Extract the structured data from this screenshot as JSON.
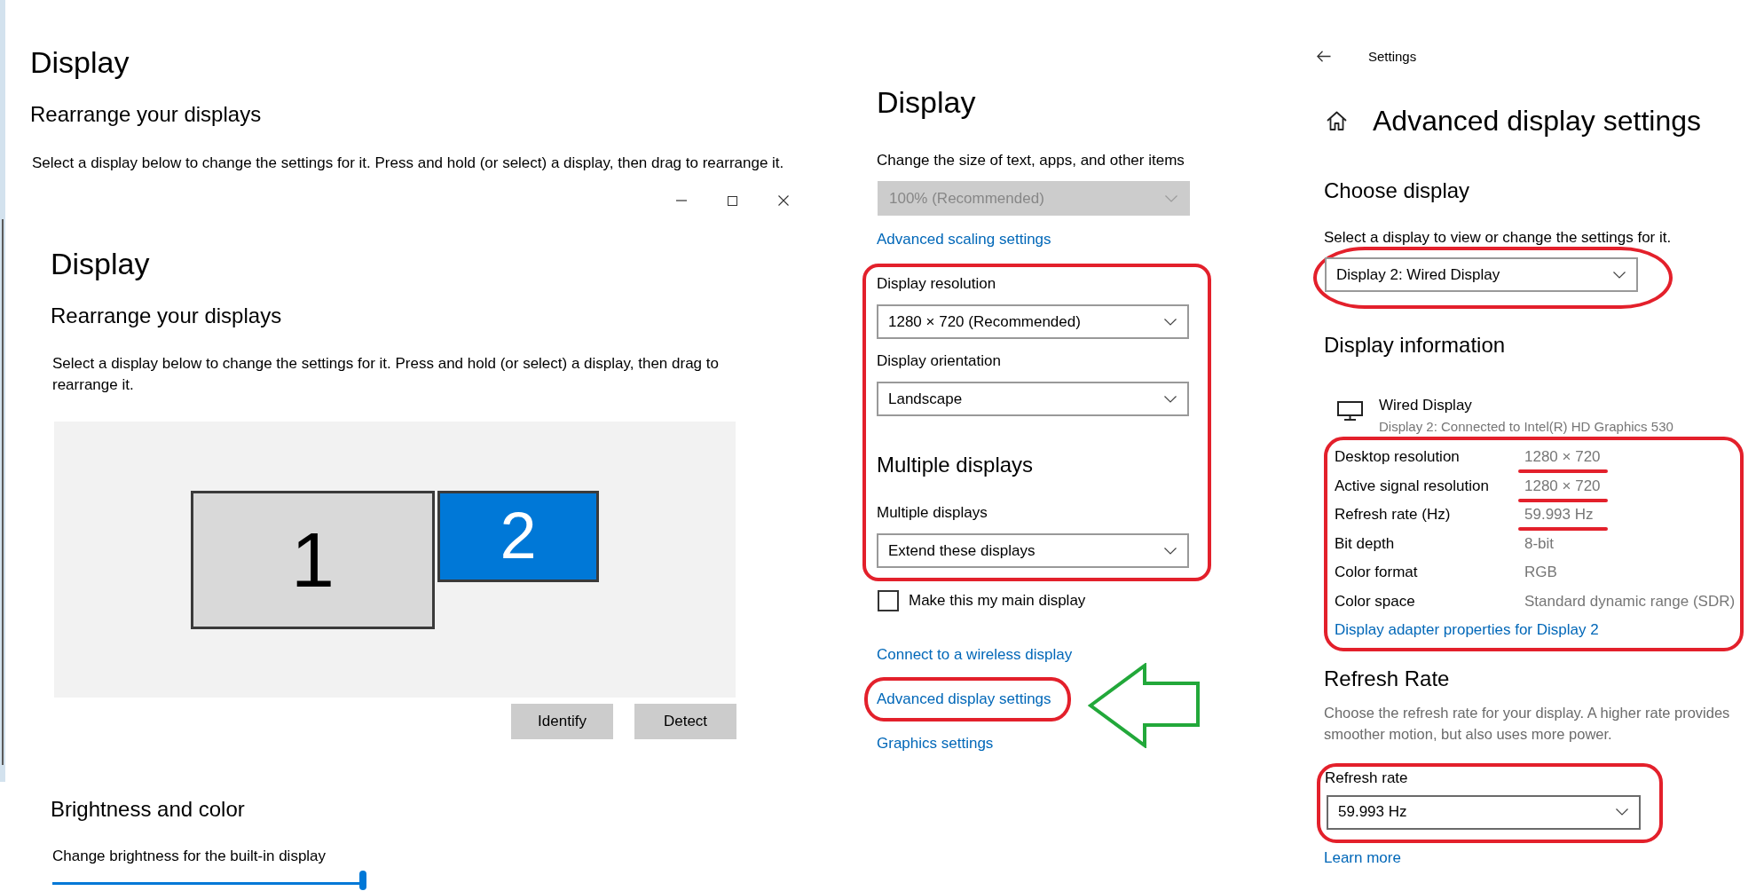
{
  "outer_window": {
    "title": "Display",
    "subtitle": "Rearrange your displays",
    "description": "Select a display below to change the settings for it. Press and hold (or select) a display, then drag to rearrange it."
  },
  "inner_window": {
    "title": "Display",
    "subtitle": "Rearrange your displays",
    "description": "Select a display below to change the settings for it. Press and hold (or select) a display, then drag to rearrange it.",
    "monitors": [
      {
        "label": "1",
        "selected": false
      },
      {
        "label": "2",
        "selected": true
      }
    ],
    "buttons": [
      "Identify",
      "Detect"
    ],
    "brightness_heading": "Brightness and color",
    "brightness_slider": {
      "label": "Change brightness for the built-in display",
      "level": 1
    }
  },
  "display_panel": {
    "title": "Display",
    "scale": {
      "label": "Change the size of text, apps, and other items",
      "value": "100% (Recommended)",
      "disabled": true
    },
    "scaling_link": "Advanced scaling settings",
    "layout_group": {
      "outlined": true,
      "items": [
        {
          "kind": "dropdown",
          "label": "Display resolution",
          "value": "1280 × 720 (Recommended)"
        },
        {
          "kind": "dropdown",
          "label": "Display orientation",
          "value": "Landscape"
        },
        {
          "kind": "heading",
          "text": "Multiple displays"
        },
        {
          "kind": "dropdown",
          "label": "Multiple displays",
          "value": "Extend these displays"
        }
      ]
    },
    "main_display": {
      "label": "Make this my main display",
      "checked": false
    },
    "links": [
      {
        "text": "Connect to a wireless display",
        "outlined": false,
        "arrow": false
      },
      {
        "text": "Advanced display settings",
        "outlined": true,
        "arrow": true
      },
      {
        "text": "Graphics settings",
        "outlined": false,
        "arrow": false
      }
    ]
  },
  "advanced_panel": {
    "back_label": "Settings",
    "title": "Advanced display settings",
    "choose_heading": "Choose display",
    "choose_description": "Select a display to view or change the settings for it.",
    "display_select": {
      "value": "Display 2: Wired Display",
      "outlined": true
    },
    "info_heading": "Display information",
    "display_name": "Wired Display",
    "display_connection": "Display 2: Connected to Intel(R) HD Graphics 530",
    "info": {
      "outlined": true,
      "rows": [
        {
          "label": "Desktop resolution",
          "value": "1280 × 720",
          "underlined": true
        },
        {
          "label": "Active signal resolution",
          "value": "1280 × 720",
          "underlined": true
        },
        {
          "label": "Refresh rate (Hz)",
          "value": "59.993 Hz",
          "underlined": true
        },
        {
          "label": "Bit depth",
          "value": "8-bit",
          "underlined": false
        },
        {
          "label": "Color format",
          "value": "RGB",
          "underlined": false
        },
        {
          "label": "Color space",
          "value": "Standard dynamic range (SDR)",
          "underlined": false
        }
      ],
      "link": "Display adapter properties for Display 2"
    },
    "refresh_heading": "Refresh Rate",
    "refresh_description": "Choose the refresh rate for your display. A higher rate provides smoother motion, but also uses more power.",
    "refresh_select": {
      "label": "Refresh rate",
      "value": "59.993 Hz",
      "outlined": true
    },
    "learn_more": "Learn more"
  }
}
